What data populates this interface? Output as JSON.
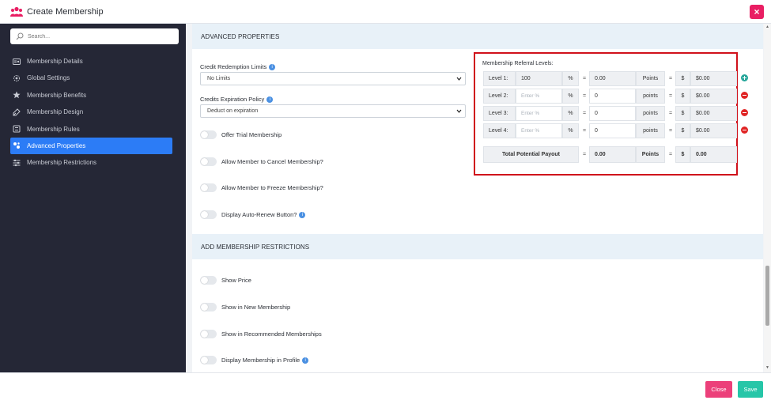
{
  "header": {
    "title": "Create Membership",
    "close_label": "×"
  },
  "sidebar": {
    "search_placeholder": "Search...",
    "items": [
      {
        "label": "Membership Details",
        "icon": "id-card-icon"
      },
      {
        "label": "Global Settings",
        "icon": "gear-icon"
      },
      {
        "label": "Membership Benefits",
        "icon": "star-icon"
      },
      {
        "label": "Membership Design",
        "icon": "design-icon"
      },
      {
        "label": "Membership Rules",
        "icon": "rules-icon"
      },
      {
        "label": "Advanced Properties",
        "icon": "advanced-icon",
        "active": true
      },
      {
        "label": "Membership Restrictions",
        "icon": "sliders-icon"
      }
    ]
  },
  "advanced": {
    "section_title": "ADVANCED PROPERTIES",
    "credit_redemption_label": "Credit Redemption Limits",
    "credit_redemption_value": "No Limits",
    "credits_expiration_label": "Credits Expiration Policy",
    "credits_expiration_value": "Deduct on expiration",
    "toggles": [
      {
        "label": "Offer Trial Membership"
      },
      {
        "label": "Allow Member to Cancel Membership?"
      },
      {
        "label": "Allow Member to Freeze Membership?"
      },
      {
        "label": "Display Auto-Renew Button?",
        "info": true
      }
    ]
  },
  "referral": {
    "title": "Membership Referral Levels:",
    "percent_sign": "%",
    "equals": "=",
    "points_label": "Points",
    "points_label_lower": "points",
    "currency_sign": "$",
    "percent_placeholder": "Enter %",
    "levels": [
      {
        "label": "Level 1:",
        "percent": "100",
        "points": "0.00",
        "amount": "$0.00",
        "action": "add"
      },
      {
        "label": "Level 2:",
        "percent": "",
        "points": "0",
        "amount": "$0.00",
        "action": "remove"
      },
      {
        "label": "Level 3:",
        "percent": "",
        "points": "0",
        "amount": "$0.00",
        "action": "remove"
      },
      {
        "label": "Level 4:",
        "percent": "",
        "points": "0",
        "amount": "$0.00",
        "action": "remove"
      }
    ],
    "total_label": "Total Potential Payout",
    "total_points": "0.00",
    "total_points_label": "Points",
    "total_amount": "0.00"
  },
  "restrictions": {
    "section_title": "ADD MEMBERSHIP RESTRICTIONS",
    "toggles": [
      {
        "label": "Show Price"
      },
      {
        "label": "Show in New Membership"
      },
      {
        "label": "Show in Recommended Memberships"
      },
      {
        "label": "Display Membership in Profile",
        "info": true
      }
    ]
  },
  "footer": {
    "close_label": "Close",
    "save_label": "Save"
  },
  "colors": {
    "accent": "#2c7cf6",
    "sidebar_bg": "#252736",
    "close": "#ec407a",
    "save": "#26c6a8",
    "highlight_border": "#d0111b"
  }
}
